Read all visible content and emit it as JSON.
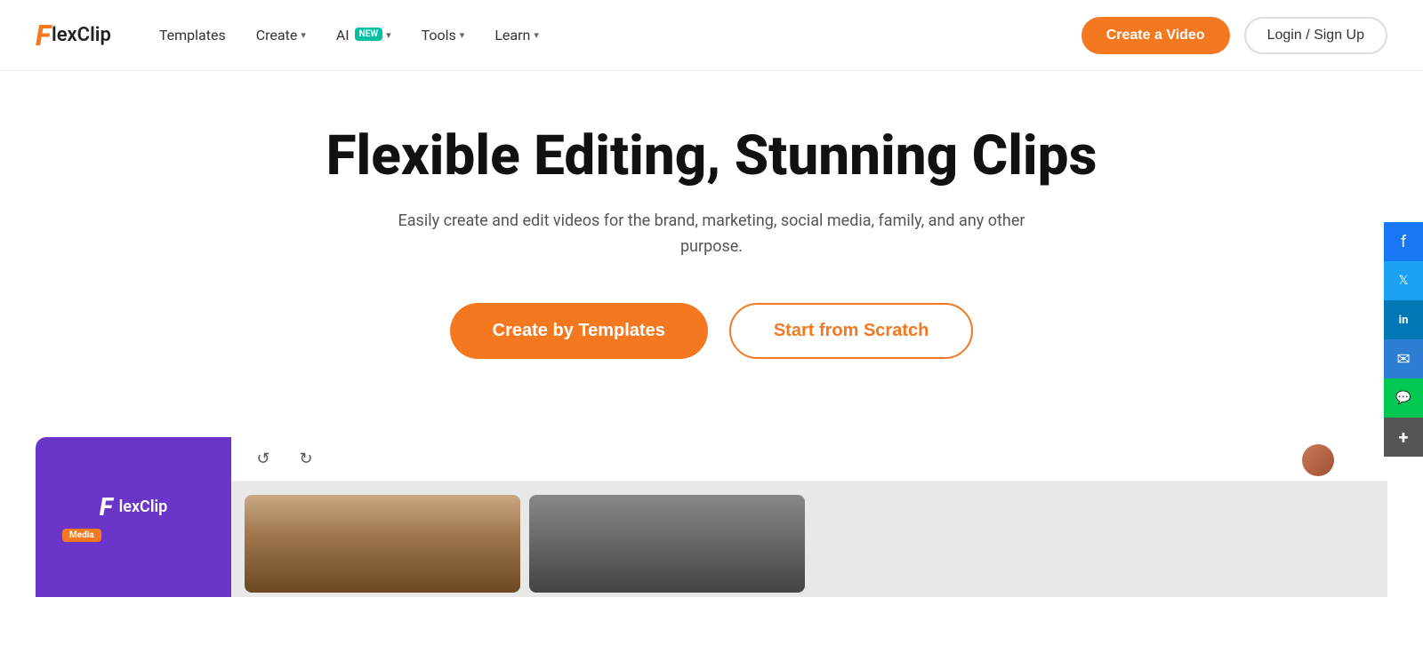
{
  "logo": {
    "f": "F",
    "text": "lexClip"
  },
  "nav": {
    "items": [
      {
        "label": "Templates",
        "hasDropdown": false
      },
      {
        "label": "Create",
        "hasDropdown": true
      },
      {
        "label": "AI",
        "hasDropdown": true,
        "badge": "NEW"
      },
      {
        "label": "Tools",
        "hasDropdown": true
      },
      {
        "label": "Learn",
        "hasDropdown": true
      }
    ],
    "createVideo": "Create a Video",
    "loginSignup": "Login / Sign Up"
  },
  "hero": {
    "title": "Flexible Editing, Stunning Clips",
    "subtitle": "Easily create and edit videos for the brand, marketing, social media, family, and any other purpose.",
    "btn_templates": "Create by Templates",
    "btn_scratch": "Start from Scratch"
  },
  "editor": {
    "sidebar_logo_f": "F",
    "sidebar_logo_text": "lexClip",
    "sidebar_tag": "Media",
    "toolbar_undo": "↺",
    "toolbar_redo": "↻"
  },
  "social": {
    "items": [
      {
        "name": "facebook",
        "label": "f"
      },
      {
        "name": "twitter",
        "label": "🐦"
      },
      {
        "name": "linkedin",
        "label": "in"
      },
      {
        "name": "email",
        "label": "✉"
      },
      {
        "name": "chat",
        "label": "💬"
      },
      {
        "name": "more",
        "label": "+"
      }
    ]
  }
}
